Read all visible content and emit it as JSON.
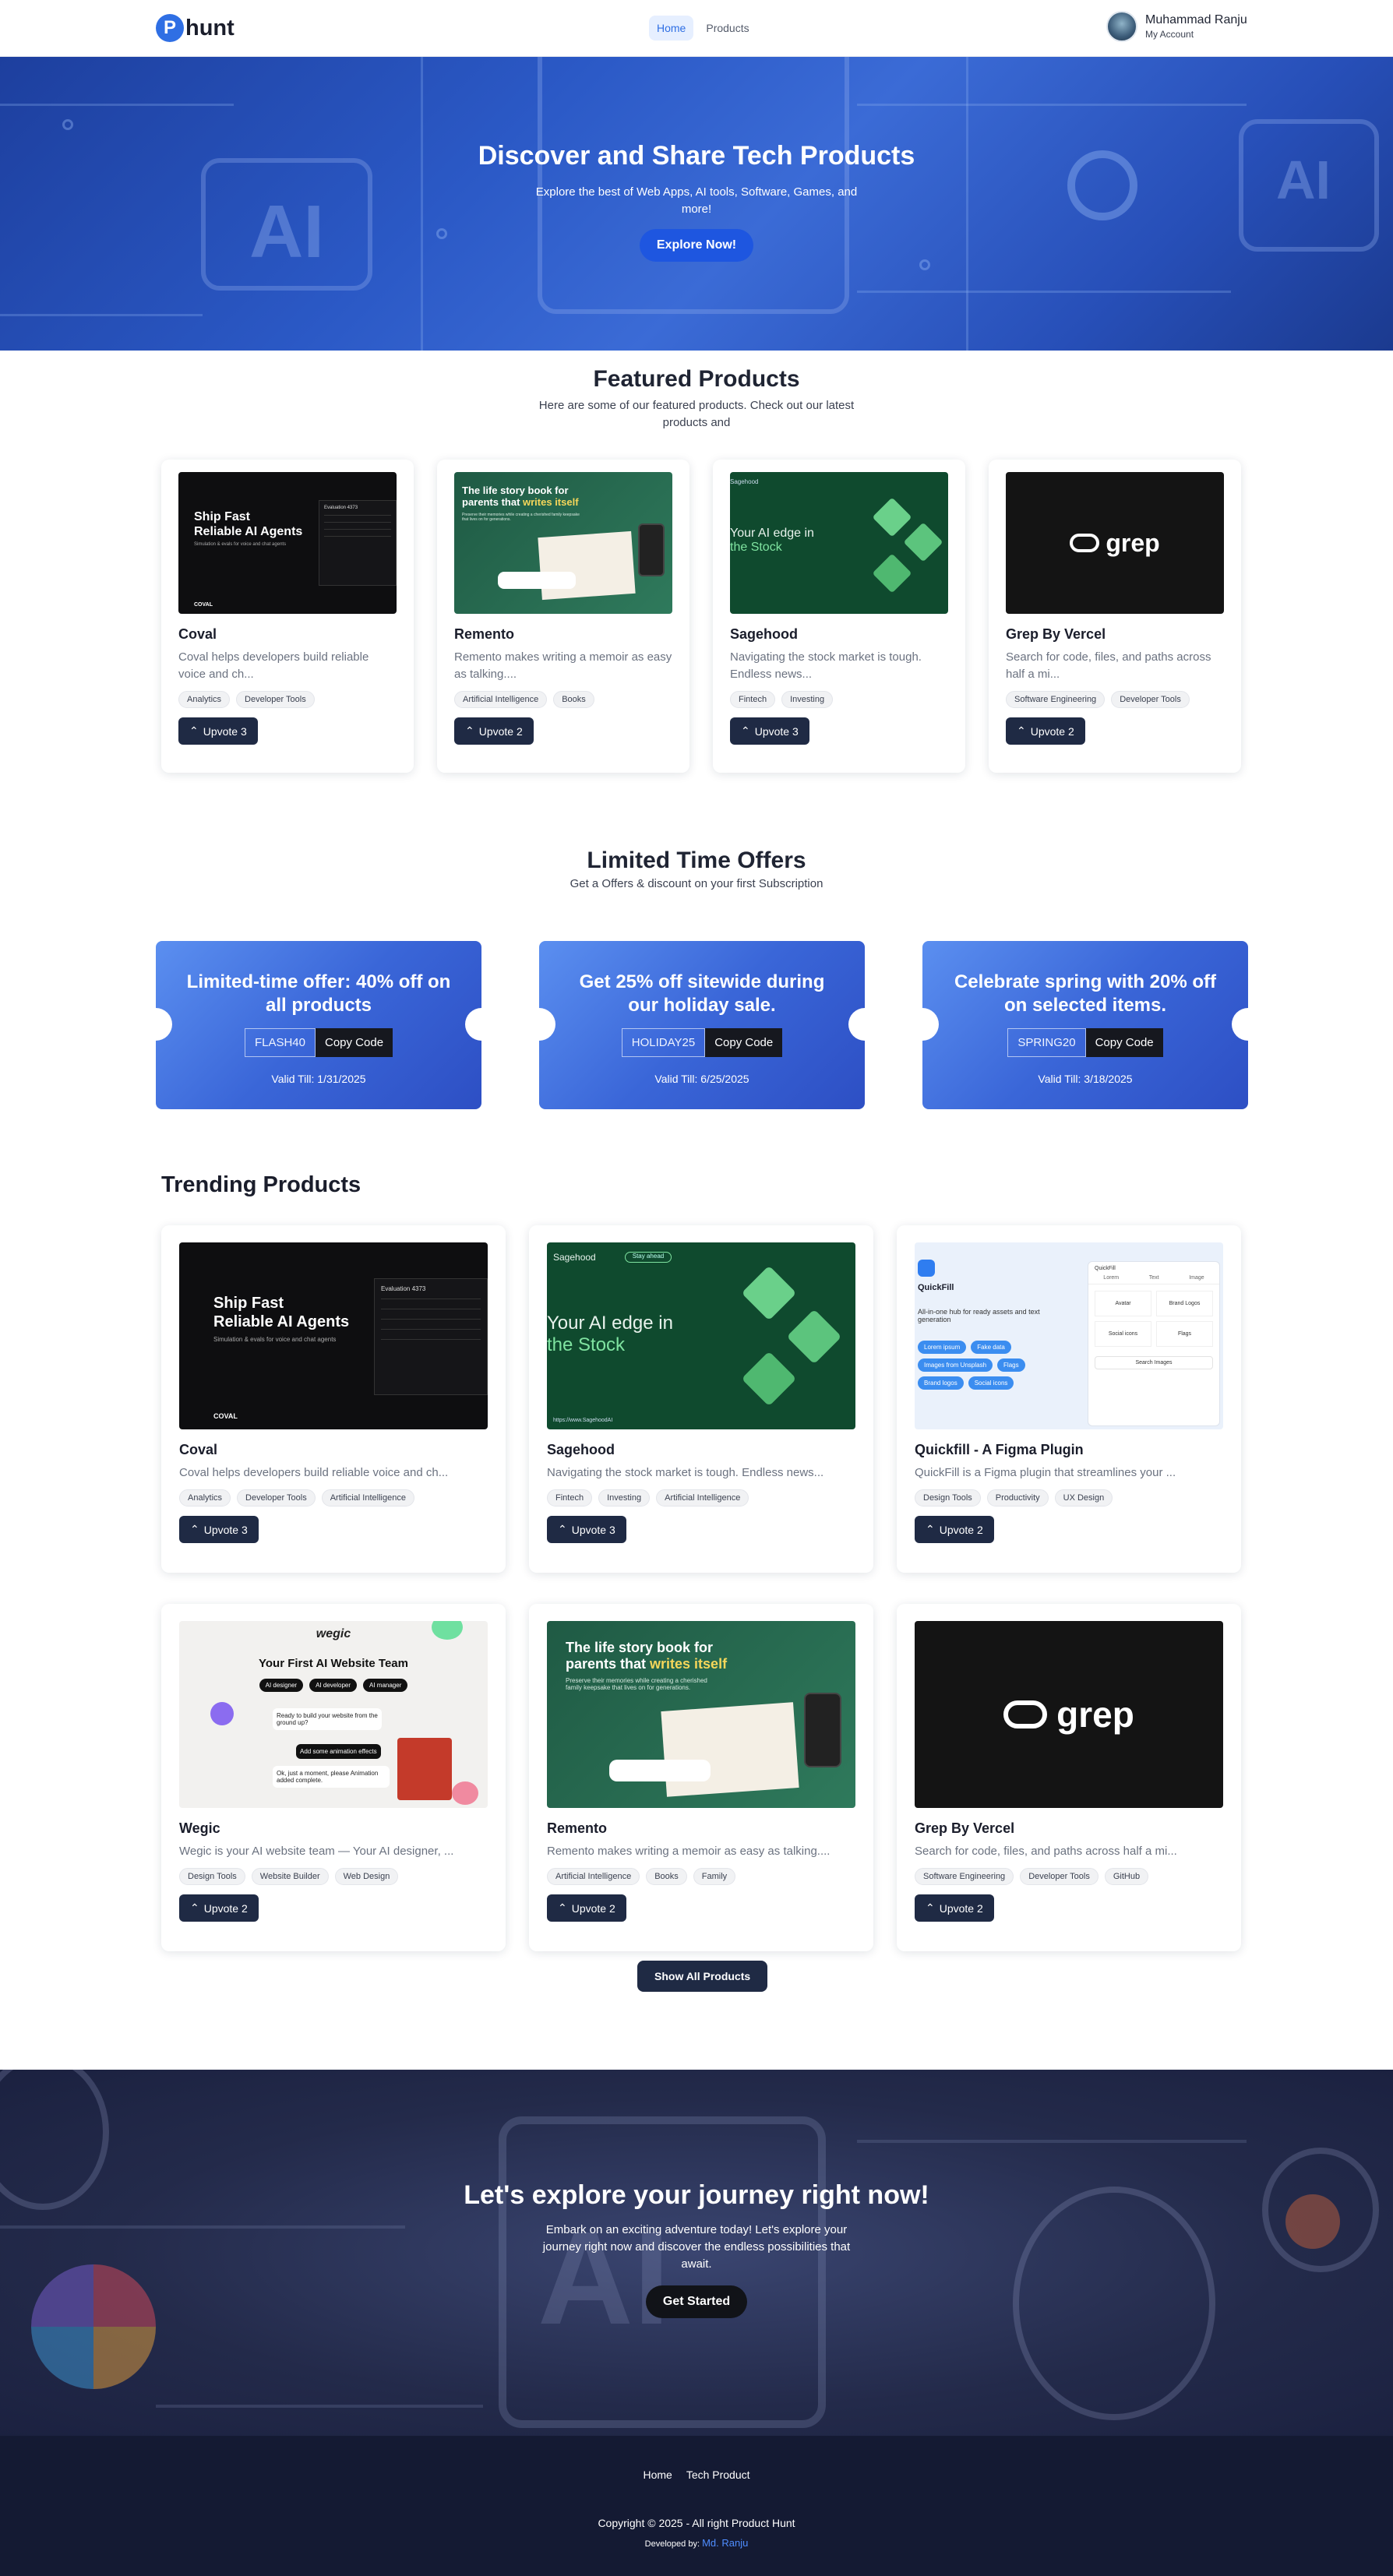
{
  "nav": {
    "logo_letter": "P",
    "logo_text": "hunt",
    "links": [
      "Home",
      "Products"
    ],
    "account_name": "Muhammad Ranju",
    "account_sub": "My Account"
  },
  "hero": {
    "title": "Discover and Share Tech Products",
    "subtitle": "Explore the best of Web Apps, AI tools, Software, Games, and more!",
    "cta": "Explore Now!",
    "bg_text": [
      "AI",
      "AI"
    ]
  },
  "featured": {
    "title": "Featured Products",
    "subtitle": "Here are some of our featured products. Check out our latest products and",
    "items": [
      {
        "name": "Coval",
        "desc": "Coval helps developers build reliable voice and ch...",
        "tags": [
          "Analytics",
          "Developer Tools"
        ],
        "upvote": "Upvote 3"
      },
      {
        "name": "Remento",
        "desc": "Remento makes writing a memoir as easy as talking....",
        "tags": [
          "Artificial Intelligence",
          "Books"
        ],
        "upvote": "Upvote 2"
      },
      {
        "name": "Sagehood",
        "desc": "Navigating the stock market is tough. Endless news...",
        "tags": [
          "Fintech",
          "Investing"
        ],
        "upvote": "Upvote 3"
      },
      {
        "name": "Grep By Vercel",
        "desc": "Search for code, files, and paths across half a mi...",
        "tags": [
          "Software Engineering",
          "Developer Tools"
        ],
        "upvote": "Upvote 2"
      }
    ]
  },
  "images": {
    "coval": {
      "line1": "Ship Fast",
      "line2": "Reliable AI Agents",
      "sub": "Simulation & evals for voice and chat agents",
      "brand": "COVAL",
      "panel": "Evaluation 4373"
    },
    "remento": {
      "line1": "The life story book for",
      "line2a": "parents that ",
      "line2b": "writes itself",
      "sub": "Preserve their memories while creating a cherished family keepsake that lives on for generations."
    },
    "sagehood": {
      "brand": "Sagehood",
      "pill": "Stay ahead",
      "line1": "Your AI edge in",
      "line2": "the Stock",
      "url": "https://www.SagehoodAI"
    },
    "grep": {
      "word": "grep"
    },
    "quickfill": {
      "title": "QuickFill",
      "desc": "All-in-one hub for ready assets and text generation",
      "pills": [
        "Lorem ipsum",
        "Fake data",
        "Images from Unsplash",
        "Flags",
        "Brand logos",
        "Social icons"
      ],
      "panel_tabs": [
        "Lorem",
        "Text",
        "Image"
      ],
      "panel_items": [
        "Avatar",
        "Brand Logos",
        "Social icons",
        "Flags"
      ],
      "search": "Search Images",
      "panel_title": "QuickFill"
    },
    "wegic": {
      "logo": "wegic",
      "title": "Your First AI Website Team",
      "roles": [
        "AI designer",
        "AI developer",
        "AI manager"
      ],
      "chat1": "Ready to build your website from the ground up?",
      "chat2": "Add some animation effects",
      "chat3": "Ok, just a moment, please Animation added complete."
    }
  },
  "offers": {
    "title": "Limited Time Offers",
    "subtitle": "Get a Offers & discount on your first Subscription",
    "items": [
      {
        "title": "Limited-time offer: 40% off on all products",
        "code": "FLASH40",
        "copy": "Copy Code",
        "valid": "Valid Till: 1/31/2025"
      },
      {
        "title": "Get 25% off sitewide during our holiday sale.",
        "code": "HOLIDAY25",
        "copy": "Copy Code",
        "valid": "Valid Till: 6/25/2025"
      },
      {
        "title": "Celebrate spring with 20% off on selected items.",
        "code": "SPRING20",
        "copy": "Copy Code",
        "valid": "Valid Till: 3/18/2025"
      }
    ]
  },
  "trending": {
    "title": "Trending Products",
    "items": [
      {
        "name": "Coval",
        "desc": "Coval helps developers build reliable voice and ch...",
        "tags": [
          "Analytics",
          "Developer Tools",
          "Artificial Intelligence"
        ],
        "upvote": "Upvote 3"
      },
      {
        "name": "Sagehood",
        "desc": "Navigating the stock market is tough. Endless news...",
        "tags": [
          "Fintech",
          "Investing",
          "Artificial Intelligence"
        ],
        "upvote": "Upvote 3"
      },
      {
        "name": "Quickfill - A Figma Plugin",
        "desc": "QuickFill is a Figma plugin that streamlines your ...",
        "tags": [
          "Design Tools",
          "Productivity",
          "UX Design"
        ],
        "upvote": "Upvote 2"
      },
      {
        "name": "Wegic",
        "desc": "Wegic is your AI website team — Your AI designer, ...",
        "tags": [
          "Design Tools",
          "Website Builder",
          "Web Design"
        ],
        "upvote": "Upvote 2"
      },
      {
        "name": "Remento",
        "desc": "Remento makes writing a memoir as easy as talking....",
        "tags": [
          "Artificial Intelligence",
          "Books",
          "Family"
        ],
        "upvote": "Upvote 2"
      },
      {
        "name": "Grep By Vercel",
        "desc": "Search for code, files, and paths across half a mi...",
        "tags": [
          "Software Engineering",
          "Developer Tools",
          "GitHub"
        ],
        "upvote": "Upvote 2"
      }
    ],
    "show_all": "Show All Products"
  },
  "cta": {
    "title": "Let's explore your journey right now!",
    "subtitle": "Embark on an exciting adventure today! Let's explore your journey right now and discover the endless possibilities that await.",
    "button": "Get Started",
    "bg_text": "AI"
  },
  "footer": {
    "links": [
      "Home",
      "Tech Product"
    ],
    "copyright": "Copyright © 2025 - All right Product Hunt",
    "dev_label": "Developed by: ",
    "dev_name": "Md. Ranju"
  },
  "colors": {
    "accent": "#2f6fe4",
    "dark_button": "#1f2a44",
    "footer_bg": "#141a33"
  }
}
